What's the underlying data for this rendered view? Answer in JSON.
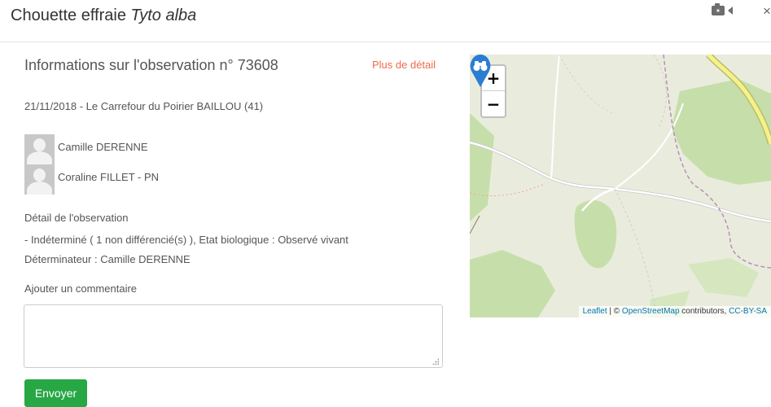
{
  "modal": {
    "species_common": "Chouette effraie",
    "species_scientific": "Tyto alba",
    "icons": [
      "camera-icon",
      "sound-icon",
      "close-icon"
    ],
    "close_symbol": "×"
  },
  "observation": {
    "title": "Informations sur l'observation n° 73608",
    "more_link": "Plus de détail",
    "date_place": "21/11/2018 - Le Carrefour du Poirier BAILLOU (41)",
    "observers": [
      {
        "name": "Camille DERENNE"
      },
      {
        "name": "Coraline FILLET - PN"
      }
    ],
    "detail_heading": "Détail de l'observation",
    "detail_line1": "- Indéterminé ( 1 non différencié(s) ), Etat biologique : Observé vivant",
    "detail_line2": "Déterminateur : Camille DERENNE"
  },
  "comment": {
    "label": "Ajouter un commentaire",
    "value": "",
    "placeholder": "",
    "submit_label": "Envoyer"
  },
  "map": {
    "zoom_in": "+",
    "zoom_out": "−",
    "attribution": {
      "leaflet": "Leaflet",
      "sep": " | © ",
      "osm": "OpenStreetMap",
      "contributors": " contributors, ",
      "license": "CC-BY-SA"
    },
    "colors": {
      "background": "#e9ecdd",
      "forest": "#c6dfaa",
      "road": "#ffffff",
      "major_road": "#f4f28a",
      "boundary": "#b48bb3",
      "marker": "#2b7dd2"
    }
  },
  "colors": {
    "accent_link": "#ef6b4a",
    "button": "#28a745"
  }
}
